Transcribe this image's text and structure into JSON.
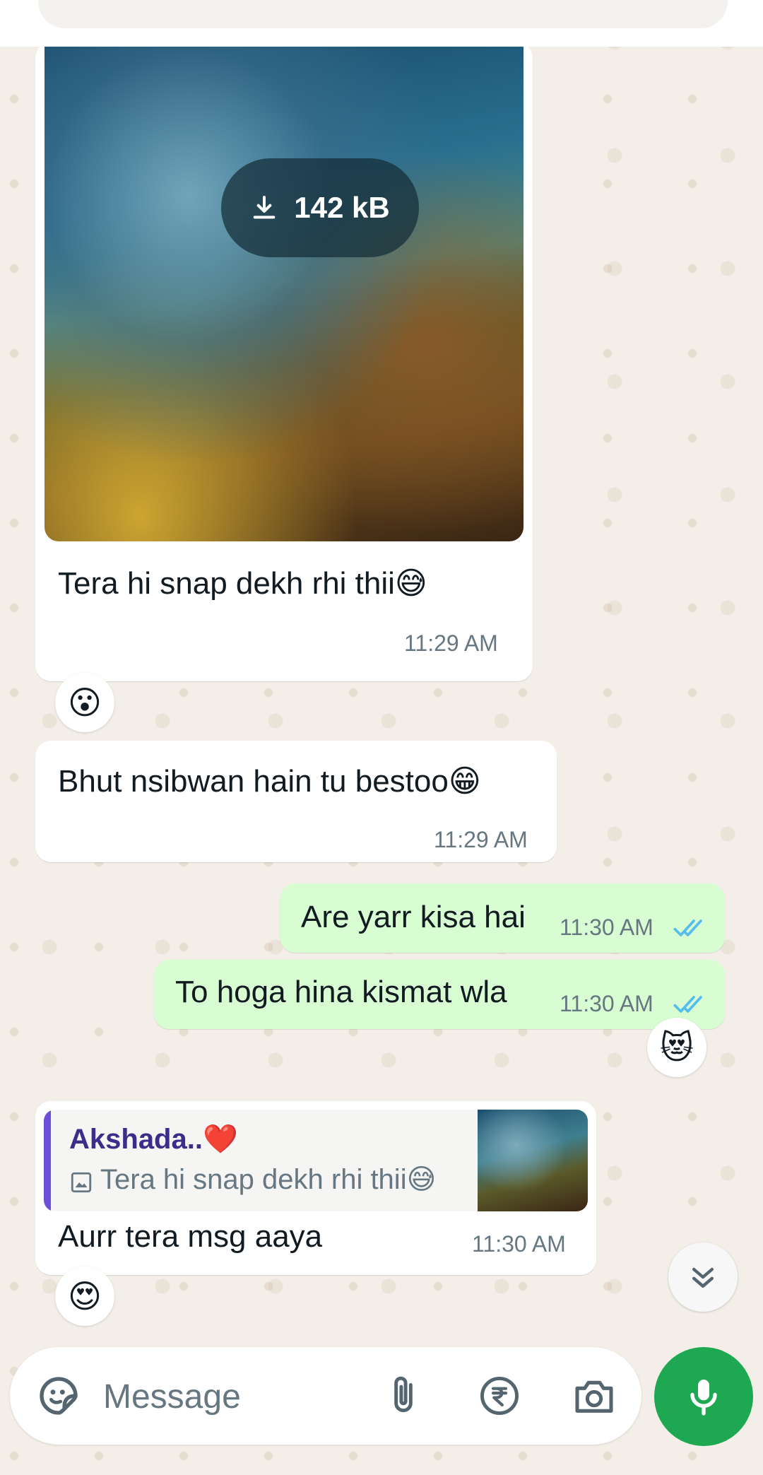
{
  "header": {
    "search_placeholder": ""
  },
  "messages": {
    "image_message": {
      "download_size": "142 kB",
      "caption": "Tera hi snap dekh rhi thii😅",
      "time": "11:29 AM",
      "reaction": "😮"
    },
    "msg2": {
      "text": "Bhut nsibwan hain tu bestoo😁",
      "time": "11:29 AM"
    },
    "msg3": {
      "text": "Are yarr kisa hai",
      "time": "11:30 AM"
    },
    "msg4": {
      "text": "To hoga hina kismat wla",
      "time": "11:30 AM",
      "reaction": "😻"
    },
    "msg5": {
      "quote_author": "Akshada..❤️",
      "quote_text": "Tera hi snap dekh rhi thii😅",
      "text": "Aurr tera msg aaya",
      "time": "11:30 AM",
      "reaction": "😍"
    }
  },
  "composer": {
    "placeholder": "Message"
  },
  "colors": {
    "outgoing_bubble": "#d9fdd3",
    "incoming_bubble": "#ffffff",
    "read_tick": "#53bdeb",
    "mic_button": "#1da851",
    "quote_bar": "#6b4fd8"
  }
}
